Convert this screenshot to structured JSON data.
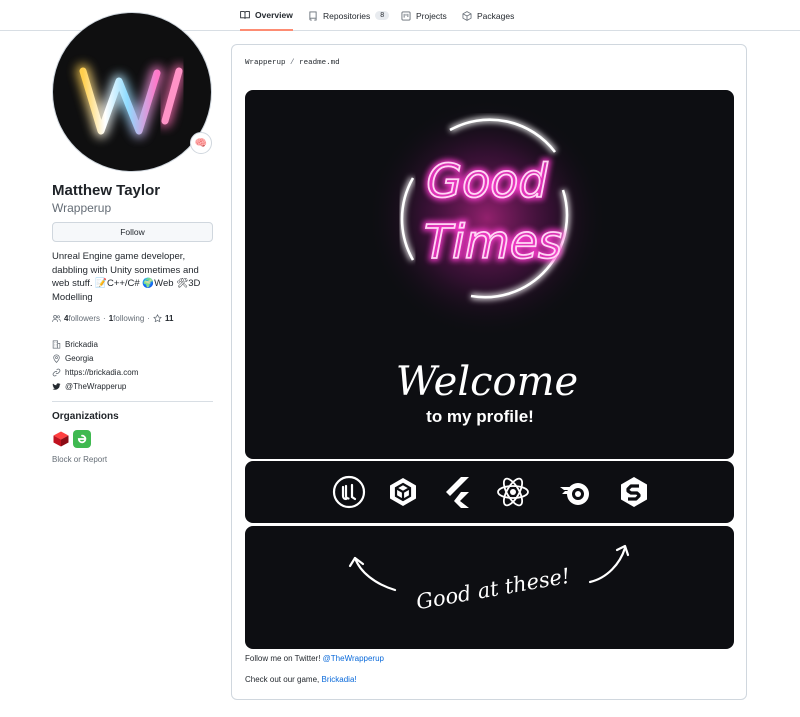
{
  "nav": {
    "tabs": [
      {
        "label": "Overview",
        "icon": "book-icon",
        "active": true
      },
      {
        "label": "Repositories",
        "icon": "repo-icon",
        "count": "8"
      },
      {
        "label": "Projects",
        "icon": "project-icon"
      },
      {
        "label": "Packages",
        "icon": "package-icon"
      }
    ]
  },
  "profile": {
    "fullname": "Matthew Taylor",
    "username": "Wrapperup",
    "status_emoji": "🧠",
    "follow_label": "Follow",
    "bio": "Unreal Engine game developer, dabbling with Unity sometimes and web stuff. 📝C++/C# 🌍Web 🛠3D Modelling",
    "followers_count": "4",
    "followers_label": " followers",
    "following_count": "1",
    "following_label": " following",
    "separator": "·",
    "stars_count": "11",
    "company": "Brickadia",
    "location": "Georgia",
    "website": "https://brickadia.com",
    "twitter": "@TheWrapperup"
  },
  "orgs": {
    "heading": "Organizations",
    "block_report": "Block or Report"
  },
  "readme": {
    "breadcrumb_owner": "Wrapperup",
    "breadcrumb_sep": "/",
    "breadcrumb_file": "readme.md",
    "banner": {
      "neon_line1": "Good",
      "neon_line2": "Times",
      "welcome": "Welcome",
      "subtitle": "to my profile!"
    },
    "tech_icons": [
      "unreal-engine-icon",
      "unity-icon",
      "flutter-icon",
      "react-icon",
      "blender-icon",
      "substance-icon"
    ],
    "good_at": "Good at these!",
    "follow_text": "Follow me on Twitter! ",
    "twitter_link": "@TheWrapperup",
    "game_text": "Check out our game, ",
    "game_link": "Brickadia!"
  },
  "colors": {
    "accent_underline": "#fd8c73",
    "link": "#0969da",
    "neon_pink": "#ff3bd0",
    "panel_bg": "#0d0e12"
  }
}
